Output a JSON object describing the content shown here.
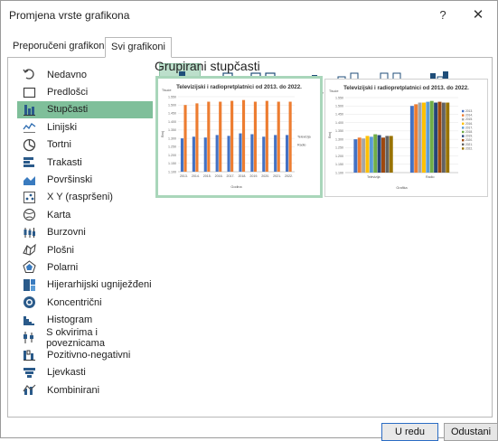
{
  "window": {
    "title": "Promjena vrste grafikona",
    "help": "?",
    "close": "✕"
  },
  "tabs": [
    {
      "label": "Preporučeni grafikoni"
    },
    {
      "label": "Svi grafikoni"
    }
  ],
  "chart_types": [
    {
      "label": "Nedavno",
      "icon": "recent-icon"
    },
    {
      "label": "Predlošci",
      "icon": "folder-icon"
    },
    {
      "label": "Stupčasti",
      "icon": "column-chart-icon"
    },
    {
      "label": "Linijski",
      "icon": "line-chart-icon"
    },
    {
      "label": "Tortni",
      "icon": "pie-chart-icon"
    },
    {
      "label": "Trakasti",
      "icon": "bar-chart-icon"
    },
    {
      "label": "Površinski",
      "icon": "area-chart-icon"
    },
    {
      "label": "X Y (raspršeni)",
      "icon": "scatter-chart-icon"
    },
    {
      "label": "Karta",
      "icon": "map-chart-icon"
    },
    {
      "label": "Burzovni",
      "icon": "stock-chart-icon"
    },
    {
      "label": "Plošni",
      "icon": "surface-chart-icon"
    },
    {
      "label": "Polarni",
      "icon": "radar-chart-icon"
    },
    {
      "label": "Hijerarhijski ugniježđeni",
      "icon": "treemap-icon"
    },
    {
      "label": "Koncentrični",
      "icon": "sunburst-icon"
    },
    {
      "label": "Histogram",
      "icon": "histogram-icon"
    },
    {
      "label": "S okvirima i poveznicama",
      "icon": "box-whisker-icon"
    },
    {
      "label": "Pozitivno-negativni",
      "icon": "waterfall-icon"
    },
    {
      "label": "Ljevkasti",
      "icon": "funnel-icon"
    },
    {
      "label": "Kombinirani",
      "icon": "combo-chart-icon"
    }
  ],
  "selected_type": "Stupčasti",
  "subtype_heading": "Grupirani stupčasti",
  "subtypes": [
    "clustered-column-icon",
    "stacked-column-icon",
    "100-stacked-column-icon",
    "3d-clustered-column-icon",
    "3d-stacked-column-icon",
    "3d-100-stacked-column-icon",
    "3d-column-icon"
  ],
  "colors": {
    "selection": "#7fbf9a",
    "selection_light": "#bcdfcb",
    "series_blue": "#4472c4",
    "series_orange": "#ed7d31"
  },
  "chart_data": [
    {
      "type": "bar",
      "title": "Televizijski i radiopretplatnici od 2013. do 2022.",
      "xlabel": "Godina",
      "ylabel": "Broj",
      "categories": [
        "2013.",
        "2014.",
        "2015.",
        "2016.",
        "2017.",
        "2018.",
        "2019.",
        "2020.",
        "2021.",
        "2022."
      ],
      "series": [
        {
          "name": "Televizija",
          "values": [
            1300,
            1310,
            1305,
            1320,
            1315,
            1330,
            1325,
            1310,
            1320,
            1320
          ]
        },
        {
          "name": "Radio",
          "values": [
            1500,
            1510,
            1520,
            1520,
            1525,
            1530,
            1520,
            1525,
            1520,
            1520
          ]
        }
      ],
      "ylim": [
        1100,
        1550
      ],
      "y_ticks": [
        "1.100",
        "1.150",
        "1.200",
        "1.250",
        "1.300",
        "1.350",
        "1.400",
        "1.450",
        "1.500",
        "1.550"
      ],
      "y_top_label": "Tisuće",
      "legend": "right"
    },
    {
      "type": "bar",
      "title": "Televizijski i radiopretplatnici od 2013. do 2022.",
      "xlabel": "Grafika",
      "ylabel": "Broj",
      "categories": [
        "Televizija",
        "Radio"
      ],
      "series": [
        {
          "name": "2013.",
          "values": [
            1300,
            1500
          ]
        },
        {
          "name": "2014.",
          "values": [
            1310,
            1510
          ]
        },
        {
          "name": "2015.",
          "values": [
            1305,
            1520
          ]
        },
        {
          "name": "2016.",
          "values": [
            1320,
            1520
          ]
        },
        {
          "name": "2017.",
          "values": [
            1315,
            1525
          ]
        },
        {
          "name": "2018.",
          "values": [
            1330,
            1530
          ]
        },
        {
          "name": "2019.",
          "values": [
            1325,
            1520
          ]
        },
        {
          "name": "2020.",
          "values": [
            1310,
            1525
          ]
        },
        {
          "name": "2021.",
          "values": [
            1320,
            1520
          ]
        },
        {
          "name": "2022.",
          "values": [
            1320,
            1520
          ]
        }
      ],
      "ylim": [
        1100,
        1550
      ],
      "y_ticks": [
        "1.100",
        "1.150",
        "1.200",
        "1.250",
        "1.300",
        "1.350",
        "1.400",
        "1.450",
        "1.500",
        "1.550"
      ],
      "y_top_label": "Tisuće",
      "legend": "right"
    }
  ],
  "buttons": {
    "ok": "U redu",
    "cancel": "Odustani"
  }
}
